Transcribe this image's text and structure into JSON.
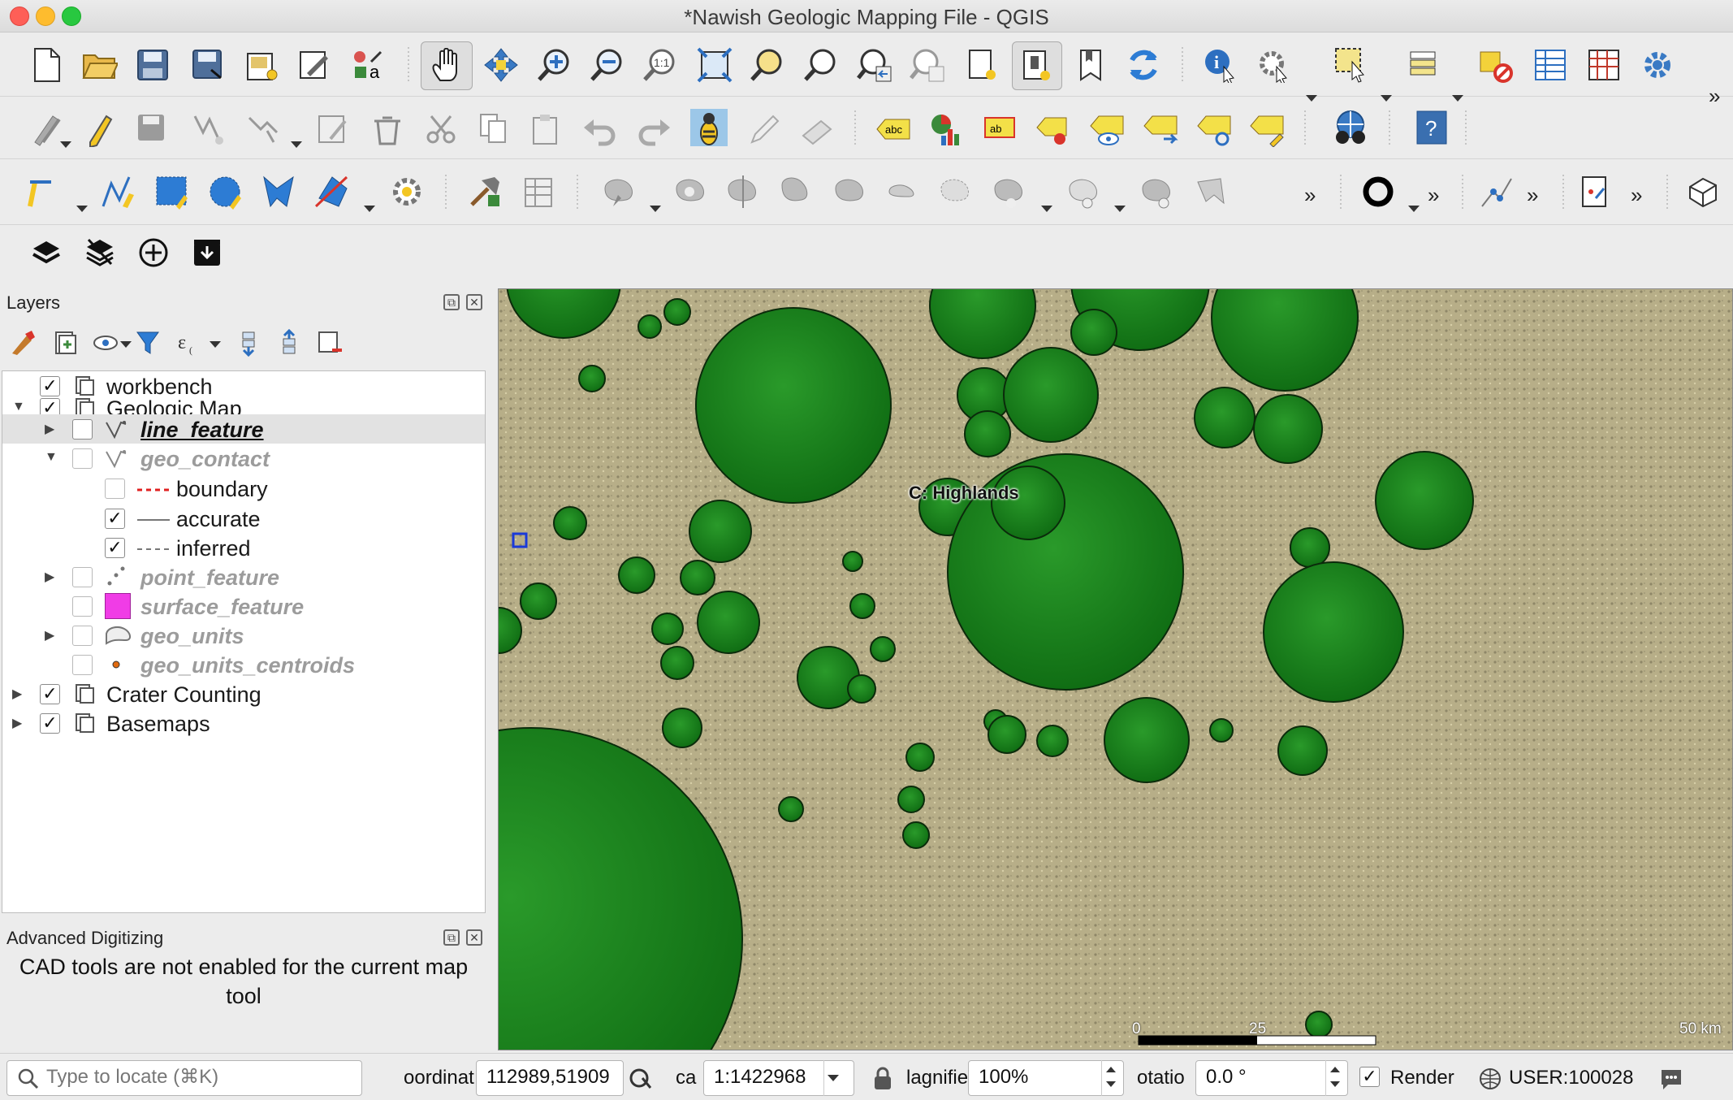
{
  "window": {
    "title": "*Nawish Geologic Mapping File - QGIS"
  },
  "layers_panel": {
    "title": "Layers",
    "items": [
      {
        "label": "workbench",
        "checked": true
      },
      {
        "label": "Geologic Map",
        "checked": true
      },
      {
        "label": "line_feature",
        "checked": false
      },
      {
        "label": "geo_contact",
        "checked": false
      },
      {
        "label": "boundary",
        "checked": false
      },
      {
        "label": "accurate",
        "checked": true
      },
      {
        "label": "inferred",
        "checked": true
      },
      {
        "label": "point_feature",
        "checked": false
      },
      {
        "label": "surface_feature",
        "checked": false
      },
      {
        "label": "geo_units",
        "checked": false
      },
      {
        "label": "geo_units_centroids",
        "checked": false
      },
      {
        "label": "Crater Counting",
        "checked": true
      },
      {
        "label": "Basemaps",
        "checked": true
      }
    ],
    "check_mark": "✓"
  },
  "adv_digitizing": {
    "title": "Advanced Digitizing",
    "message": "CAD tools are not enabled for the current map tool"
  },
  "map": {
    "label": "C: Highlands",
    "scalebar": {
      "ticks": [
        "0",
        "25",
        "50 km"
      ]
    },
    "colors": {
      "crater_fill": "#1d8a1f",
      "terrain": "#b9b08a"
    }
  },
  "toolbar": {
    "overflow": "»"
  },
  "statusbar": {
    "search_placeholder": "Type to locate (⌘K)",
    "coord_label": "oordinat",
    "coord_value": "112989,51909",
    "scale_label": "ca",
    "scale_value": "1:1422968",
    "magnifier_label": "lagnifie",
    "magnifier_value": "100%",
    "rotation_label": "otatio",
    "rotation_value": "0.0 °",
    "render_label": "Render",
    "render_checked": true,
    "crs": "USER:100028"
  }
}
